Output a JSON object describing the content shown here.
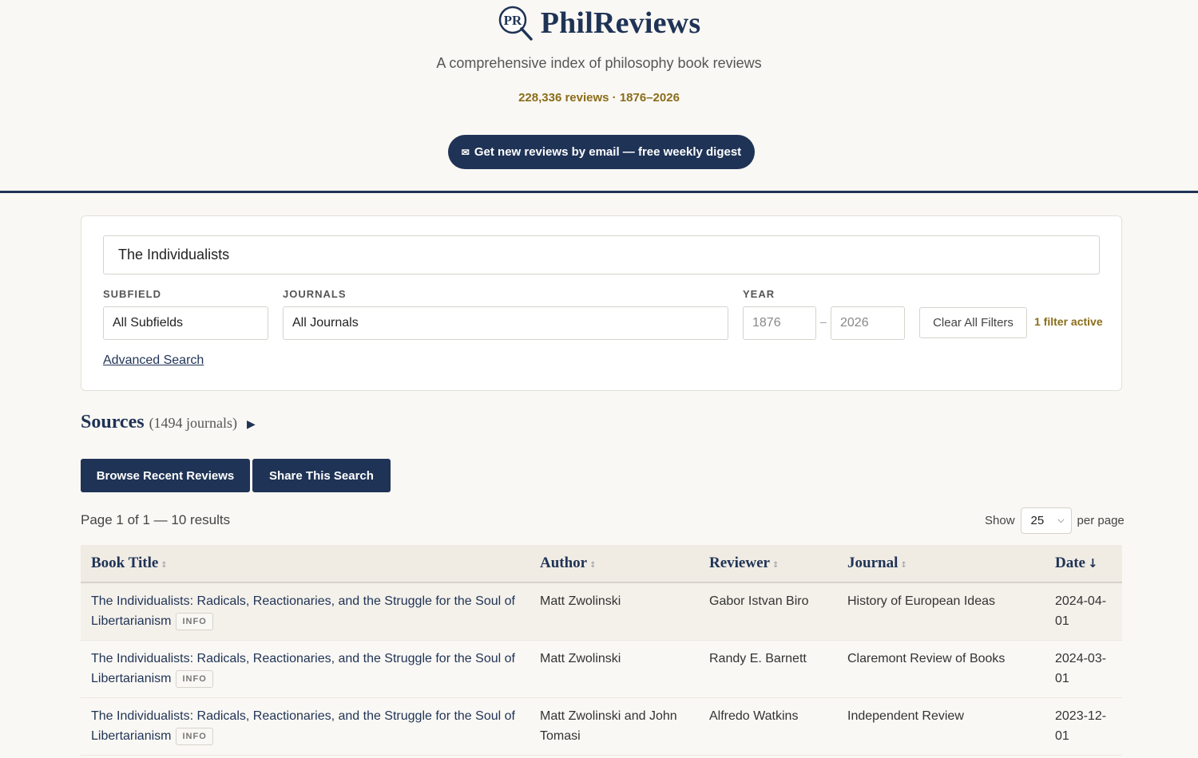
{
  "header": {
    "site_name": "PhilReviews",
    "logo_letters": "PR",
    "tagline": "A comprehensive index of philosophy book reviews",
    "stats": "228,336 reviews · 1876–2026",
    "digest_icon": "✉",
    "digest_label": "Get new reviews by email — free weekly digest"
  },
  "search": {
    "query": "The Individualists",
    "subfield_label": "SUBFIELD",
    "subfield_value": "All Subfields",
    "journals_label": "JOURNALS",
    "journals_value": "All Journals",
    "year_label": "YEAR",
    "year_from": "1876",
    "year_to": "2026",
    "year_sep": "–",
    "clear_label": "Clear All Filters",
    "filter_status": "1 filter active",
    "advanced_label": "Advanced Search"
  },
  "sources": {
    "title": "Sources",
    "count": "(1494 journals)",
    "toggle_icon": "▶"
  },
  "actions": {
    "browse_label": "Browse Recent Reviews",
    "share_label": "Share This Search"
  },
  "pagination": {
    "info": "Page 1 of 1 — 10 results",
    "show_label": "Show",
    "per_page_value": "25",
    "per_page_suffix": "per page"
  },
  "table": {
    "columns": [
      {
        "label": "Book Title",
        "sort": "↕"
      },
      {
        "label": "Author",
        "sort": "↕"
      },
      {
        "label": "Reviewer",
        "sort": "↕"
      },
      {
        "label": "Journal",
        "sort": "↕"
      },
      {
        "label": "Date",
        "sort": "↓"
      }
    ],
    "info_label": "INFO",
    "rows": [
      {
        "title": "The Individualists: Radicals, Reactionaries, and the Struggle for the Soul of Libertarianism",
        "author": "Matt Zwolinski",
        "reviewer": "Gabor Istvan Biro",
        "journal": "History of European Ideas",
        "date": "2024-04-01"
      },
      {
        "title": "The Individualists: Radicals, Reactionaries, and the Struggle for the Soul of Libertarianism",
        "author": "Matt Zwolinski",
        "reviewer": "Randy E. Barnett",
        "journal": "Claremont Review of Books",
        "date": "2024-03-01"
      },
      {
        "title": "The Individualists: Radicals, Reactionaries, and the Struggle for the Soul of Libertarianism",
        "author": "Matt Zwolinski and John Tomasi",
        "reviewer": "Alfredo Watkins",
        "journal": "Independent Review",
        "date": "2023-12-01"
      }
    ]
  }
}
